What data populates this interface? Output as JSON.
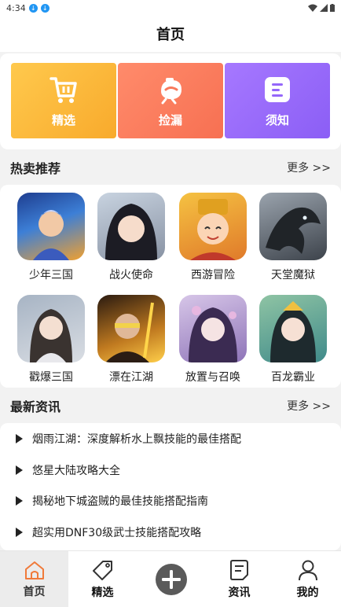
{
  "status_bar": {
    "time": "4:34"
  },
  "header": {
    "title": "首页"
  },
  "quick": [
    {
      "label": "精选",
      "icon": "cart-icon",
      "color": "#f8b637"
    },
    {
      "label": "捡漏",
      "icon": "piggy-bank-icon",
      "color": "#f87a5c"
    },
    {
      "label": "须知",
      "icon": "list-doc-icon",
      "color": "#9567fa"
    }
  ],
  "hot": {
    "title": "热卖推荐",
    "more": "更多 >>",
    "games": [
      {
        "name": "少年三国"
      },
      {
        "name": "战火使命"
      },
      {
        "name": "西游冒险"
      },
      {
        "name": "天堂魔狱"
      },
      {
        "name": "戳爆三国"
      },
      {
        "name": "漂在江湖"
      },
      {
        "name": "放置与召唤"
      },
      {
        "name": "百龙霸业"
      }
    ]
  },
  "news": {
    "title": "最新资讯",
    "more": "更多 >>",
    "items": [
      "烟雨江湖：深度解析水上飘技能的最佳搭配",
      "悠星大陆攻略大全",
      "揭秘地下城盗贼的最佳技能搭配指南",
      "超实用DNF30级武士技能搭配攻略"
    ]
  },
  "tabbar": {
    "home": "首页",
    "featured": "精选",
    "news": "资讯",
    "mine": "我的"
  }
}
